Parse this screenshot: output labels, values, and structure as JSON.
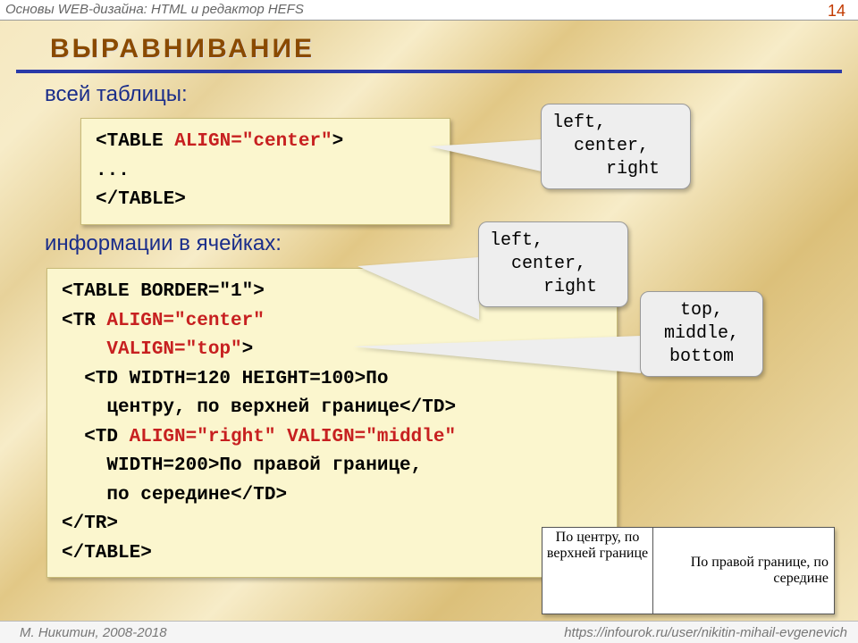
{
  "colors": {
    "accent_red": "#c72020",
    "heading_brown": "#8a4a00",
    "link_blue": "#1a2d8a"
  },
  "header": "Основы WEB-дизайна: HTML и редактор HEFS",
  "page_number": "14",
  "footer_left": "М. Никитин, 2008-2018",
  "footer_right": "https://infourok.ru/user/nikitin-mihail-evgenevich",
  "title": "ВЫРАВНИВАНИЕ",
  "subtitle1": "всей таблицы:",
  "subtitle2": "информации в ячейках:",
  "code1": {
    "l1a": "<TABLE ",
    "l1b": "ALIGN=\"center\"",
    "l1c": ">",
    "l2": "...",
    "l3": "</TABLE>"
  },
  "code2": {
    "l1": "<TABLE BORDER=\"1\">",
    "l2a": "<TR ",
    "l2b": "ALIGN=\"center\"",
    "l3a": "    ",
    "l3b": "VALIGN=\"top\"",
    "l3c": ">",
    "l4": "  <TD WIDTH=120 HEIGHT=100>По",
    "l5": "    центру, по верхней границе</TD>",
    "l6a": "  <TD ",
    "l6b": "ALIGN=\"right\"",
    "l6c": " ",
    "l6d": "VALIGN=\"middle\"",
    "l7": "    WIDTH=200>По правой границе,",
    "l8": "    по середине</TD>",
    "l9": "</TR>",
    "l10": "</TABLE>"
  },
  "callout1": "left,\n  center,\n     right",
  "callout2": "left,\n  center,\n     right",
  "callout3": "top,\nmiddle,\nbottom",
  "example": {
    "cell_a": "По центру, по верхней границе",
    "cell_b": "По правой границе, по середине"
  }
}
